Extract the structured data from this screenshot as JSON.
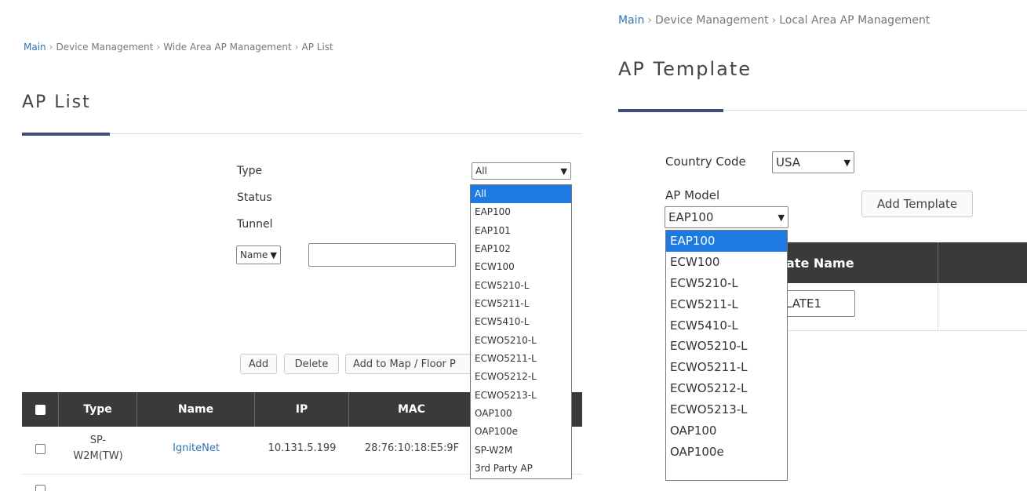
{
  "left": {
    "breadcrumb": [
      "Main",
      "Device Management",
      "Wide Area AP Management",
      "AP List"
    ],
    "breadcrumb_sep": "›",
    "title": "AP List",
    "filters": {
      "type_label": "Type",
      "status_label": "Status",
      "tunnel_label": "Tunnel",
      "type_value": "All",
      "search_field_value": "Name",
      "search_text": ""
    },
    "type_options": [
      "All",
      "EAP100",
      "EAP101",
      "EAP102",
      "ECW100",
      "ECW5210-L",
      "ECW5211-L",
      "ECW5410-L",
      "ECWO5210-L",
      "ECWO5211-L",
      "ECWO5212-L",
      "ECWO5213-L",
      "OAP100",
      "OAP100e",
      "SP-W2M",
      "3rd Party AP"
    ],
    "type_selected_index": 0,
    "buttons": {
      "add": "Add",
      "delete": "Delete",
      "add_to_map": "Add to Map / Floor P"
    },
    "table": {
      "headers": [
        "Type",
        "Name",
        "IP",
        "MAC"
      ],
      "rows": [
        {
          "type": "SP-\nW2M(TW)",
          "name": "IgniteNet",
          "ip": "10.131.5.199",
          "mac": "28:76:10:18:E5:9F"
        }
      ]
    }
  },
  "right": {
    "breadcrumb": [
      "Main",
      "Device Management",
      "Local Area AP Management"
    ],
    "breadcrumb_sep": "›",
    "title": "AP Template",
    "country_label": "Country Code",
    "country_value": "USA",
    "model_label": "AP Model",
    "model_value": "EAP100",
    "add_template": "Add Template",
    "model_options": [
      "EAP100",
      "ECW100",
      "ECW5210-L",
      "ECW5211-L",
      "ECW5410-L",
      "ECWO5210-L",
      "ECWO5211-L",
      "ECWO5212-L",
      "ECWO5213-L",
      "OAP100",
      "OAP100e"
    ],
    "model_selected_index": 0,
    "table_header": "ate Name",
    "row_value": "LATE1"
  },
  "colors": {
    "accent": "#3f4d7a",
    "link": "#2f74b5",
    "selected": "#1e7ae3",
    "table_header": "#3a3a3a"
  }
}
